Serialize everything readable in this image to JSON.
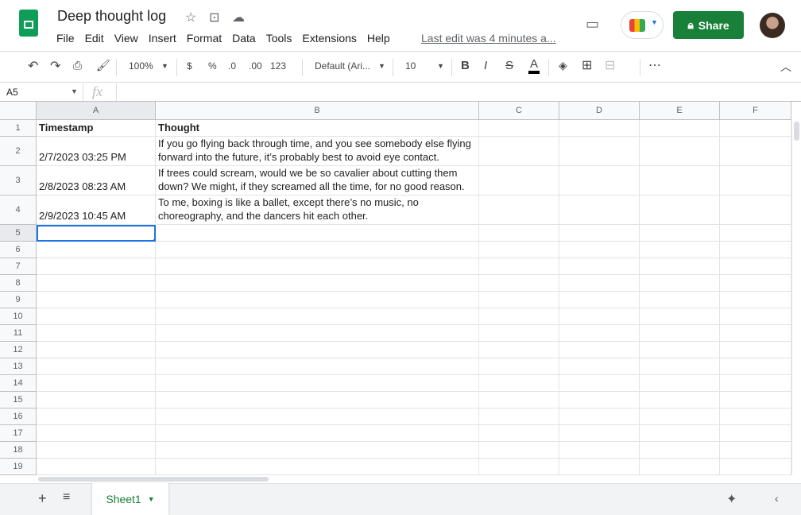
{
  "app": {
    "title": "Deep thought log",
    "menu": [
      "File",
      "Edit",
      "View",
      "Insert",
      "Format",
      "Data",
      "Tools",
      "Extensions",
      "Help"
    ],
    "last_edit": "Last edit was 4 minutes a...",
    "share_label": "Share",
    "accent": "#188038"
  },
  "toolbar": {
    "zoom": "100%",
    "currency": "$",
    "percent": "%",
    "dec_decrease": ".0",
    "dec_increase": ".00",
    "format_more": "123",
    "font": "Default (Ari...",
    "font_size": "10",
    "bold": "B",
    "italic": "I",
    "strike": "S",
    "text_color": "A"
  },
  "formula_bar": {
    "cell_ref": "A5",
    "fx": "fx",
    "value": ""
  },
  "sheet": {
    "columns": [
      "A",
      "B",
      "C",
      "D",
      "E",
      "F"
    ],
    "row_count": 19,
    "rows": [
      [
        "Timestamp",
        "Thought"
      ],
      [
        "2/7/2023 03:25 PM",
        "If you go flying back through time, and you see somebody else flying forward into the future, it’s probably best to avoid eye contact."
      ],
      [
        "2/8/2023 08:23 AM",
        "If trees could scream, would we be so cavalier about cutting them down? We might, if they screamed all the time, for no good reason."
      ],
      [
        "2/9/2023 10:45 AM",
        "To me, boxing is like a ballet, except there’s no music, no choreography, and the dancers hit each other."
      ]
    ],
    "selected_cell": "A5"
  },
  "tabs": [
    {
      "label": "Sheet1",
      "active": true
    }
  ]
}
